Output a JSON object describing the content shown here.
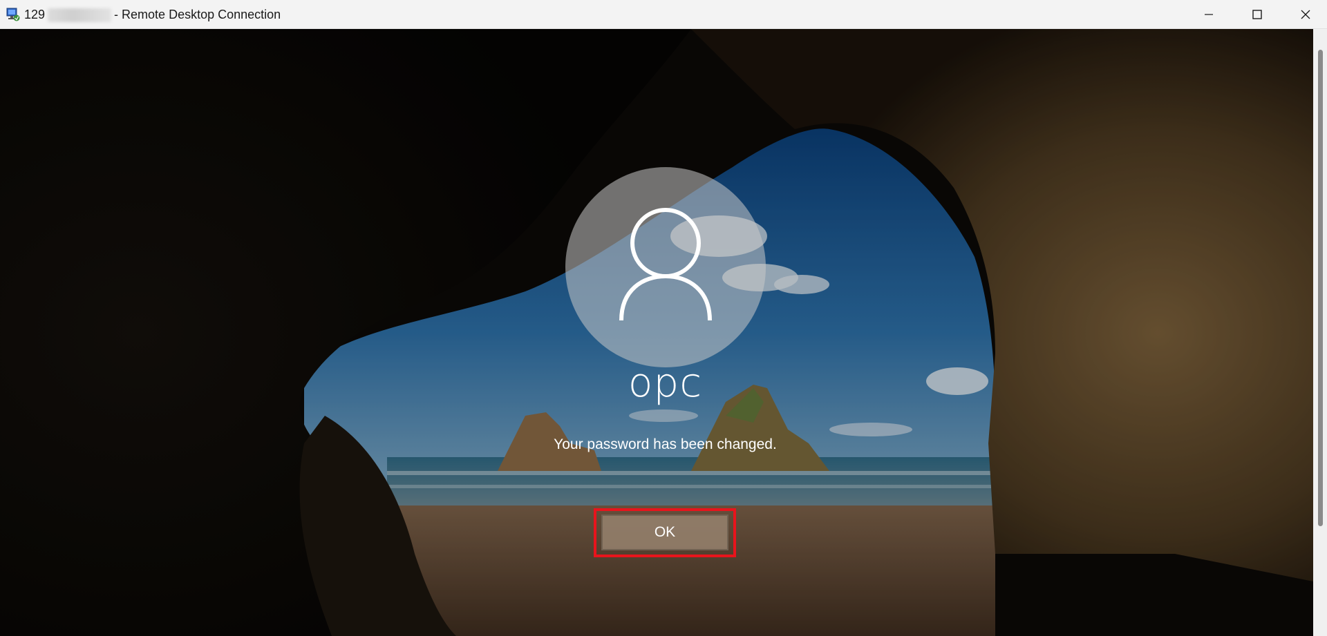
{
  "window": {
    "title_prefix": "129",
    "title_suffix": "- Remote Desktop Connection",
    "app_icon": "remote-desktop-icon",
    "controls": {
      "minimize_icon": "minimize-icon",
      "maximize_icon": "maximize-icon",
      "close_icon": "close-icon"
    }
  },
  "lock_screen": {
    "avatar_icon": "user-avatar-icon",
    "username": "opc",
    "message": "Your password has been changed.",
    "ok_label": "OK",
    "highlight_color": "#e8141c"
  }
}
